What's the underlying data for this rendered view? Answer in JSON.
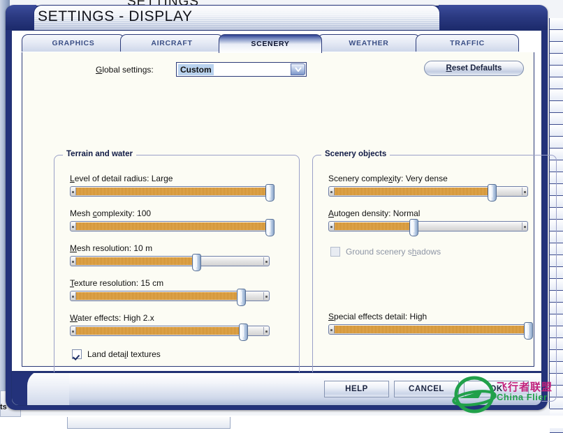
{
  "window": {
    "title": "SETTINGS - DISPLAY",
    "background_title": "SETTINGS"
  },
  "tabs": [
    {
      "label": "GRAPHICS",
      "active": false
    },
    {
      "label": "AIRCRAFT",
      "active": false
    },
    {
      "label": "SCENERY",
      "active": true
    },
    {
      "label": "WEATHER",
      "active": false
    },
    {
      "label": "TRAFFIC",
      "active": false
    }
  ],
  "toolbar": {
    "global_settings_label": "Global settings:",
    "global_settings_value": "Custom",
    "reset_defaults_label": "Reset Defaults"
  },
  "groups": {
    "terrain": {
      "title": "Terrain and water",
      "sliders": [
        {
          "label": "Level of detail radius: Large",
          "value_text": "Large",
          "percent": 100
        },
        {
          "label": "Mesh complexity: 100",
          "value_text": "100",
          "percent": 100
        },
        {
          "label": "Mesh resolution: 10 m",
          "value_text": "10 m",
          "percent": 62
        },
        {
          "label": "Texture resolution: 15 cm",
          "value_text": "15 cm",
          "percent": 85
        },
        {
          "label": "Water effects: High 2.x",
          "value_text": "High 2.x",
          "percent": 86
        }
      ],
      "checkbox": {
        "label": "Land detail textures",
        "checked": true,
        "enabled": true
      }
    },
    "scenery": {
      "title": "Scenery objects",
      "sliders": [
        {
          "label": "Scenery complexity: Very dense",
          "value_text": "Very dense",
          "percent": 81
        },
        {
          "label": "Autogen density: Normal",
          "value_text": "Normal",
          "percent": 42
        },
        {
          "label": "Special effects detail: High",
          "value_text": "High",
          "percent": 100
        }
      ],
      "checkbox": {
        "label": "Ground scenery shadows",
        "checked": false,
        "enabled": false
      }
    }
  },
  "footer": {
    "help_label": "HELP",
    "cancel_label": "CANCEL",
    "ok_label": "OK"
  },
  "watermark": {
    "cn": "飞行者联盟",
    "en": "China Flier"
  },
  "background": {
    "corner_fragment": "ts"
  },
  "colors": {
    "frame_blue": "#23327a",
    "slider_fill": "#d99c3a",
    "content_bg": "#fcfcf4",
    "tab_text": "#3b4f86",
    "watermark_green": "#21a04a"
  }
}
